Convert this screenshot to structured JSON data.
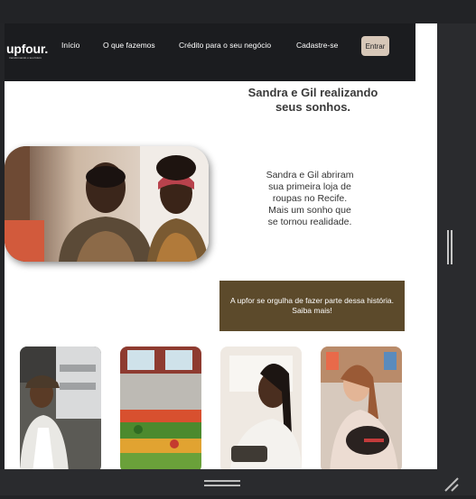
{
  "brand": {
    "name": "upfour.",
    "tagline": "transformando o seu futuro"
  },
  "nav": {
    "links": [
      "Início",
      "O que fazemos",
      "Crédito para o seu negócio",
      "Cadastre-se"
    ],
    "login_label": "Entrar"
  },
  "hero": {
    "title_line1": "Sandra e Gil realizando",
    "title_line2": "seus sonhos.",
    "story_lines": [
      "Sandra e Gil abriram",
      "sua primeira loja de",
      "roupas no Recife.",
      "Mais um sonho que",
      "se tornou realidade."
    ]
  },
  "cta": {
    "line1": "A upfor se orgulha de fazer parte dessa história.",
    "line2": "Saiba mais!"
  },
  "colors": {
    "navbar": "#1b1c1f",
    "accent_button": "#d7c7b8",
    "cta_background": "#5c4a2b",
    "page_background": "#ffffff",
    "chrome": "#2a2b2e"
  },
  "icons": [
    "scrollbar-handle-icon",
    "horizontal-handle-icon",
    "resize-corner-icon"
  ]
}
